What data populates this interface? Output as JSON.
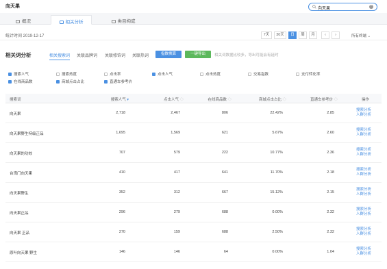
{
  "header": {
    "title": "向天果",
    "search_value": "向天果"
  },
  "main_tabs": [
    {
      "label": "概况"
    },
    {
      "label": "相关分析"
    },
    {
      "label": "类目构成"
    }
  ],
  "date_row": {
    "stat_time": "统计时间 2019-12-17",
    "ranges": [
      "7天",
      "30天",
      "日",
      "周",
      "月"
    ],
    "active_range": "日",
    "terminal": "所有终端"
  },
  "section": {
    "title": "相关词分析",
    "sub_tabs": [
      "相关搜索词",
      "关联品牌词",
      "关联修饰词",
      "关联热词"
    ],
    "btn_index": "指数换算",
    "btn_export": "一键导出",
    "note": "相关词数据比较多，导出可能会有延时"
  },
  "checkboxes": [
    {
      "label": "搜索人气",
      "checked": true
    },
    {
      "label": "搜索热度",
      "checked": false
    },
    {
      "label": "点击率",
      "checked": false
    },
    {
      "label": "点击人气",
      "checked": true
    },
    {
      "label": "点击热度",
      "checked": false
    },
    {
      "label": "交易指数",
      "checked": false
    },
    {
      "label": "支付转化率",
      "checked": false
    },
    {
      "label": "在线商品数",
      "checked": true
    },
    {
      "label": "商城点击占比",
      "checked": true
    },
    {
      "label": "直通车参考价",
      "checked": true
    }
  ],
  "table": {
    "headers": [
      "搜索词",
      "搜索人气",
      "点击人气",
      "在线商品数",
      "商城点击占比",
      "直通车参考价",
      "操作"
    ],
    "link1": "搜索分析",
    "link2": "人群分析",
    "rows": [
      {
        "word": "向天果",
        "search": "2,718",
        "click": "2,467",
        "online": "806",
        "ratio": "22.42%",
        "price": "2.85"
      },
      {
        "word": "向天果野生特级正品",
        "search": "1,695",
        "click": "1,569",
        "online": "621",
        "ratio": "5.67%",
        "price": "2.60"
      },
      {
        "word": "向天果的功效",
        "search": "707",
        "click": "579",
        "online": "222",
        "ratio": "10.77%",
        "price": "2.36"
      },
      {
        "word": "台湾门向天果",
        "search": "410",
        "click": "417",
        "online": "641",
        "ratio": "11.70%",
        "price": "2.18"
      },
      {
        "word": "向天果野生",
        "search": "352",
        "click": "312",
        "online": "667",
        "ratio": "15.12%",
        "price": "2.15"
      },
      {
        "word": "向天果正品",
        "search": "296",
        "click": "279",
        "online": "688",
        "ratio": "0.00%",
        "price": "2.32"
      },
      {
        "word": "向天果 正品",
        "search": "270",
        "click": "159",
        "online": "688",
        "ratio": "2.50%",
        "price": "2.32"
      },
      {
        "word": "原叶向天果 野生",
        "search": "146",
        "click": "146",
        "online": "64",
        "ratio": "0.00%",
        "price": "1.04"
      }
    ]
  }
}
